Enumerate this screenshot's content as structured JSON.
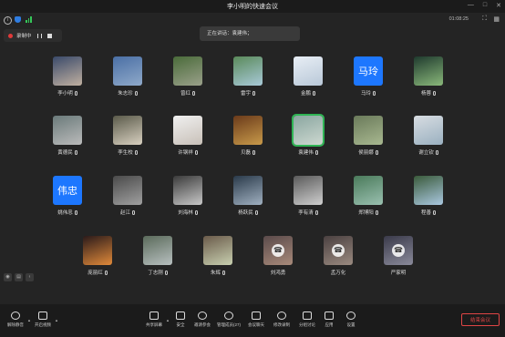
{
  "window": {
    "title": "李小明的快速会议",
    "minimize": "—",
    "maximize": "□",
    "close": "✕"
  },
  "topbar": {
    "timer": "01:08:25"
  },
  "recording": {
    "label": "录制中"
  },
  "speaking": {
    "text": "正在讲话：袁建伟；"
  },
  "participants": [
    {
      "name": "李小明",
      "avatar_colors": [
        "#3a4a6a",
        "#c0b0a0"
      ]
    },
    {
      "name": "朱志珍",
      "avatar_colors": [
        "#4a6fa5",
        "#8fa9c9"
      ]
    },
    {
      "name": "曾红",
      "avatar_colors": [
        "#4a6b3a",
        "#9aa08a"
      ]
    },
    {
      "name": "雷宇",
      "avatar_colors": [
        "#5a8a5a",
        "#a8c9d8"
      ]
    },
    {
      "name": "金鹏",
      "avatar_colors": [
        "#e8eef5",
        "#b9c8d8"
      ]
    },
    {
      "name": "马玲",
      "avatar_text": "马玲"
    },
    {
      "name": "杨蓉",
      "avatar_colors": [
        "#1f3a2e",
        "#8ab87a"
      ]
    },
    {
      "name": "黄德民",
      "avatar_colors": [
        "#6a7a7a",
        "#bbb"
      ]
    },
    {
      "name": "李生校",
      "avatar_colors": [
        "#5a5a4a",
        "#d8d0c0"
      ]
    },
    {
      "name": "许钢祥",
      "avatar_colors": [
        "#f0f0f0",
        "#c8c0b8"
      ]
    },
    {
      "name": "贝磊",
      "avatar_colors": [
        "#6a3a1a",
        "#c89a4a"
      ]
    },
    {
      "name": "袁建伟",
      "avatar_colors": [
        "#8aa6a0",
        "#cdd8d0"
      ]
    },
    {
      "name": "侯丽娜",
      "avatar_colors": [
        "#6a7a5a",
        "#a8b890"
      ]
    },
    {
      "name": "谢立钦",
      "avatar_colors": [
        "#d8dde2",
        "#9ab0c0"
      ]
    },
    {
      "name": "姚伟忠",
      "avatar_text": "伟忠"
    },
    {
      "name": "赵江",
      "avatar_colors": [
        "#4a4a4a",
        "#a0a0a0"
      ]
    },
    {
      "name": "刘海林",
      "avatar_colors": [
        "#3a3a3a",
        "#c8c8c8"
      ]
    },
    {
      "name": "杨跃民",
      "avatar_colors": [
        "#2a3a4a",
        "#a0b0c0"
      ]
    },
    {
      "name": "李有清",
      "avatar_colors": [
        "#5a5a5a",
        "#cfcfcf"
      ]
    },
    {
      "name": "郑博阳",
      "avatar_colors": [
        "#4a7a5a",
        "#9ac0b0"
      ]
    },
    {
      "name": "程善",
      "avatar_colors": [
        "#3a5a3a",
        "#aac8e0"
      ]
    },
    {
      "name": "庞丽红",
      "avatar_colors": [
        "#2a1a1a",
        "#e08a3a"
      ]
    },
    {
      "name": "丁志刚",
      "avatar_colors": [
        "#5a6a5a",
        "#b8c0c0"
      ]
    },
    {
      "name": "朱辉",
      "avatar_colors": [
        "#6a5a4a",
        "#c8d0b0"
      ]
    },
    {
      "name": "刘鸿勇",
      "avatar_colors": [
        "#5a4a4a",
        "#a88a7a"
      ],
      "phone": true
    },
    {
      "name": "孟万化",
      "avatar_colors": [
        "#4a4040",
        "#9a8a80"
      ],
      "phone": true
    },
    {
      "name": "严家明",
      "avatar_colors": [
        "#3a3a4a",
        "#8a8a9a"
      ],
      "phone": true
    }
  ],
  "toolbar": {
    "unmute": "解除静音",
    "video": "开启视频",
    "share": "共享屏幕",
    "security": "安全",
    "invite": "邀请参会",
    "members": "管理成员(27)",
    "chat": "会议聊天",
    "transcript": "修改录制",
    "breakout": "分组讨论",
    "apps": "应用",
    "settings": "设置",
    "end": "结束会议"
  },
  "colors": {
    "accent_green": "#2fb454",
    "accent_blue": "#1d77ff",
    "danger": "#e04545"
  }
}
